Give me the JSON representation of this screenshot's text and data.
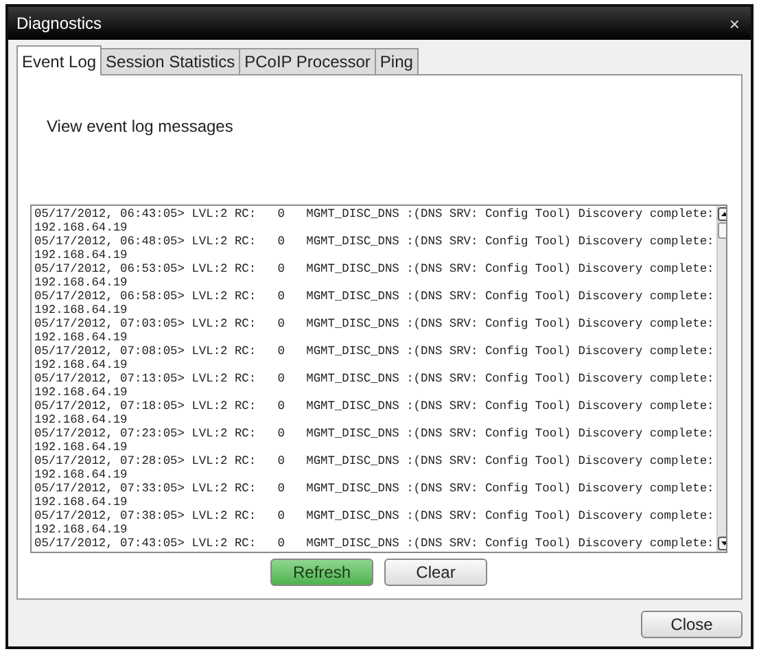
{
  "window": {
    "title": "Diagnostics",
    "close_glyph": "×"
  },
  "tabs": [
    {
      "label": "Event Log",
      "selected": true
    },
    {
      "label": "Session Statistics",
      "selected": false
    },
    {
      "label": "PCoIP Processor",
      "selected": false
    },
    {
      "label": "Ping",
      "selected": false
    }
  ],
  "description": "View event log messages",
  "log": [
    {
      "line": "05/17/2012, 06:43:05> LVL:2 RC:   0   MGMT_DISC_DNS :(DNS SRV: Config Tool) Discovery complete:",
      "ip": "192.168.64.19"
    },
    {
      "line": "05/17/2012, 06:48:05> LVL:2 RC:   0   MGMT_DISC_DNS :(DNS SRV: Config Tool) Discovery complete:",
      "ip": "192.168.64.19"
    },
    {
      "line": "05/17/2012, 06:53:05> LVL:2 RC:   0   MGMT_DISC_DNS :(DNS SRV: Config Tool) Discovery complete:",
      "ip": "192.168.64.19"
    },
    {
      "line": "05/17/2012, 06:58:05> LVL:2 RC:   0   MGMT_DISC_DNS :(DNS SRV: Config Tool) Discovery complete:",
      "ip": "192.168.64.19"
    },
    {
      "line": "05/17/2012, 07:03:05> LVL:2 RC:   0   MGMT_DISC_DNS :(DNS SRV: Config Tool) Discovery complete:",
      "ip": "192.168.64.19"
    },
    {
      "line": "05/17/2012, 07:08:05> LVL:2 RC:   0   MGMT_DISC_DNS :(DNS SRV: Config Tool) Discovery complete:",
      "ip": "192.168.64.19"
    },
    {
      "line": "05/17/2012, 07:13:05> LVL:2 RC:   0   MGMT_DISC_DNS :(DNS SRV: Config Tool) Discovery complete:",
      "ip": "192.168.64.19"
    },
    {
      "line": "05/17/2012, 07:18:05> LVL:2 RC:   0   MGMT_DISC_DNS :(DNS SRV: Config Tool) Discovery complete:",
      "ip": "192.168.64.19"
    },
    {
      "line": "05/17/2012, 07:23:05> LVL:2 RC:   0   MGMT_DISC_DNS :(DNS SRV: Config Tool) Discovery complete:",
      "ip": "192.168.64.19"
    },
    {
      "line": "05/17/2012, 07:28:05> LVL:2 RC:   0   MGMT_DISC_DNS :(DNS SRV: Config Tool) Discovery complete:",
      "ip": "192.168.64.19"
    },
    {
      "line": "05/17/2012, 07:33:05> LVL:2 RC:   0   MGMT_DISC_DNS :(DNS SRV: Config Tool) Discovery complete:",
      "ip": "192.168.64.19"
    },
    {
      "line": "05/17/2012, 07:38:05> LVL:2 RC:   0   MGMT_DISC_DNS :(DNS SRV: Config Tool) Discovery complete:",
      "ip": "192.168.64.19"
    },
    {
      "line": "05/17/2012, 07:43:05> LVL:2 RC:   0   MGMT_DISC_DNS :(DNS SRV: Config Tool) Discovery complete:"
    }
  ],
  "log_buttons": [
    {
      "label": "Refresh",
      "kind": "primary"
    },
    {
      "label": "Clear",
      "kind": "normal"
    }
  ],
  "footer_buttons": [
    {
      "label": "Close"
    }
  ]
}
